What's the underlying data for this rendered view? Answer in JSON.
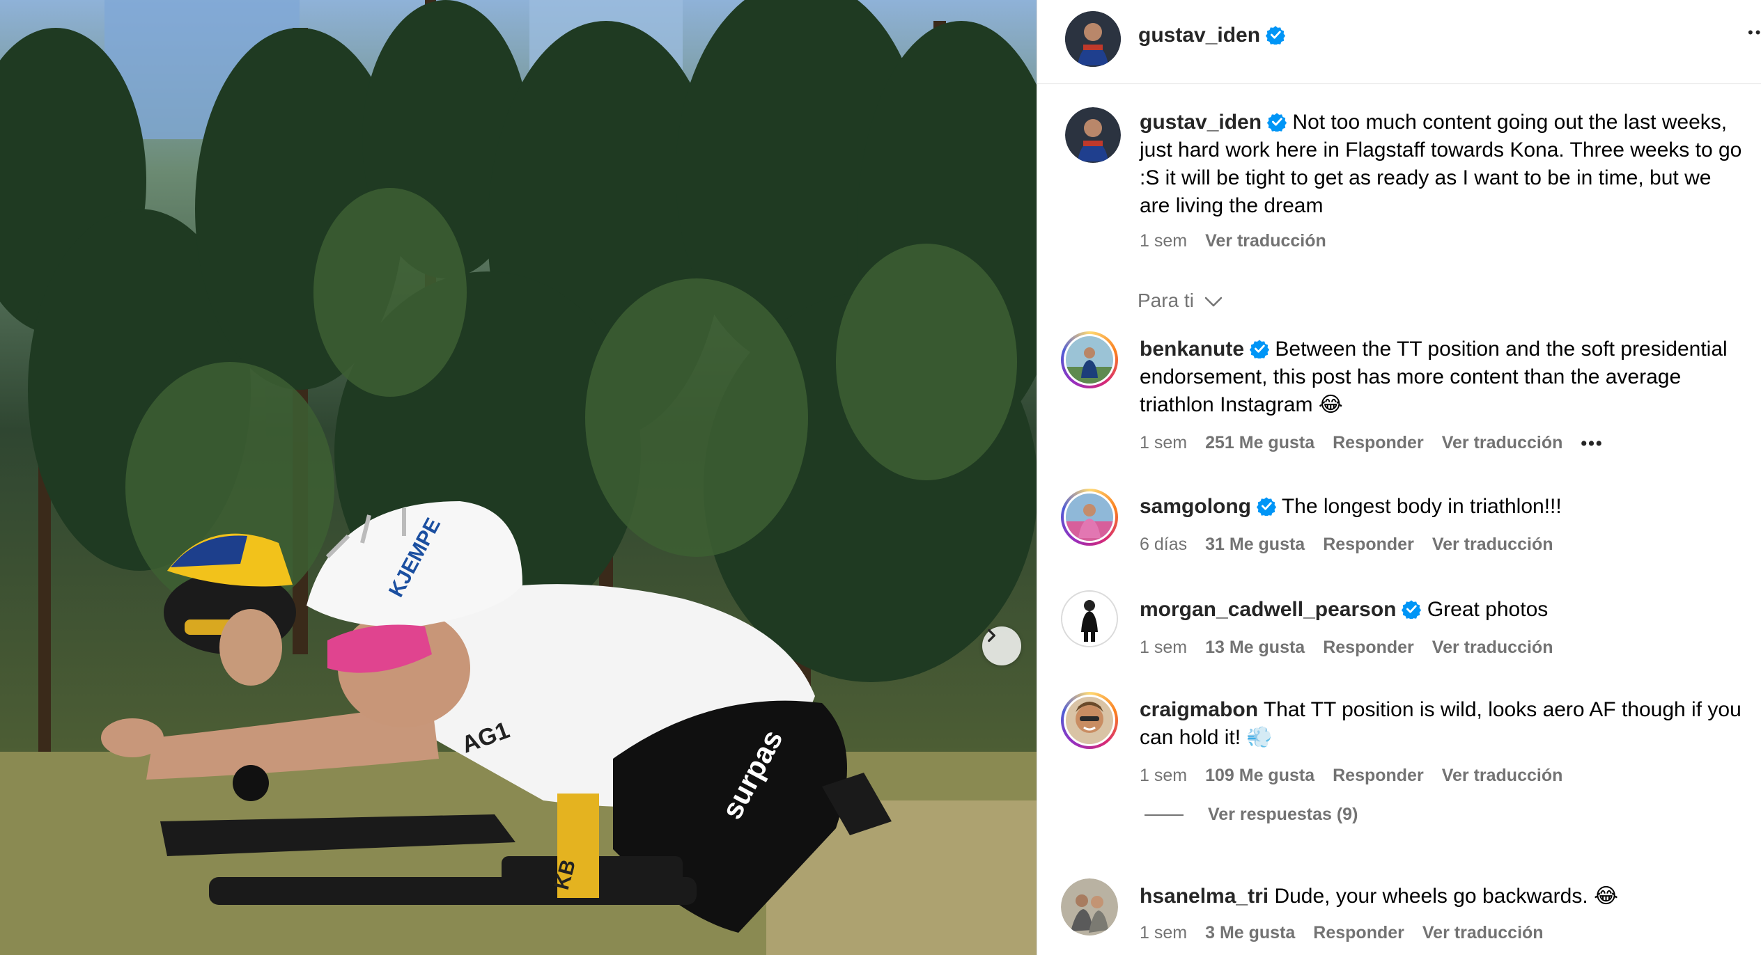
{
  "post": {
    "author": "gustav_iden",
    "caption": "Not too much content going out the last weeks, just hard work here in Flagstaff towards Kona. Three weeks to go :S it will be tight to get as ready as I want to be in time, but we are living the dream",
    "time": "1 sem",
    "see_translation": "Ver traducción"
  },
  "header": {
    "username": "gustav_iden",
    "more_label": "•••"
  },
  "photo": {
    "helmet_text": "KJEMPE",
    "jersey_text": "AG1",
    "sponsor_text": "surpas",
    "frame_text": "KB",
    "next_label": "›"
  },
  "sort": {
    "label": "Para ti"
  },
  "comments": [
    {
      "username": "benkanute",
      "verified": true,
      "text": "Between the TT position and the soft presidential endorsement, this post has more content than the average triathlon Instagram 😂",
      "time": "1 sem",
      "likes": "251 Me gusta",
      "reply": "Responder",
      "translate": "Ver traducción",
      "more": "•••"
    },
    {
      "username": "samgolong",
      "verified": true,
      "text": "The longest body in triathlon!!!",
      "time": "6 días",
      "likes": "31 Me gusta",
      "reply": "Responder",
      "translate": "Ver traducción"
    },
    {
      "username": "morgan_cadwell_pearson",
      "verified": true,
      "text": "Great photos",
      "time": "1 sem",
      "likes": "13 Me gusta",
      "reply": "Responder",
      "translate": "Ver traducción"
    },
    {
      "username": "craigmabon",
      "verified": false,
      "text": "That TT position is wild, looks aero AF though if you can hold it! 💨",
      "time": "1 sem",
      "likes": "109 Me gusta",
      "reply": "Responder",
      "translate": "Ver traducción",
      "view_replies": "Ver respuestas (9)"
    },
    {
      "username": "hsanelma_tri",
      "verified": false,
      "text": "Dude, your wheels go backwards. 😂",
      "time": "1 sem",
      "likes": "3 Me gusta",
      "reply": "Responder",
      "translate": "Ver traducción"
    }
  ],
  "colors": {
    "verified_blue": "#0095f6",
    "meta_gray": "#737373",
    "divider": "#efefef"
  },
  "icons": {
    "verified": "verified-badge-icon",
    "chevron": "chevron-down-icon",
    "next": "chevron-right-icon",
    "more": "more-horizontal-icon"
  }
}
